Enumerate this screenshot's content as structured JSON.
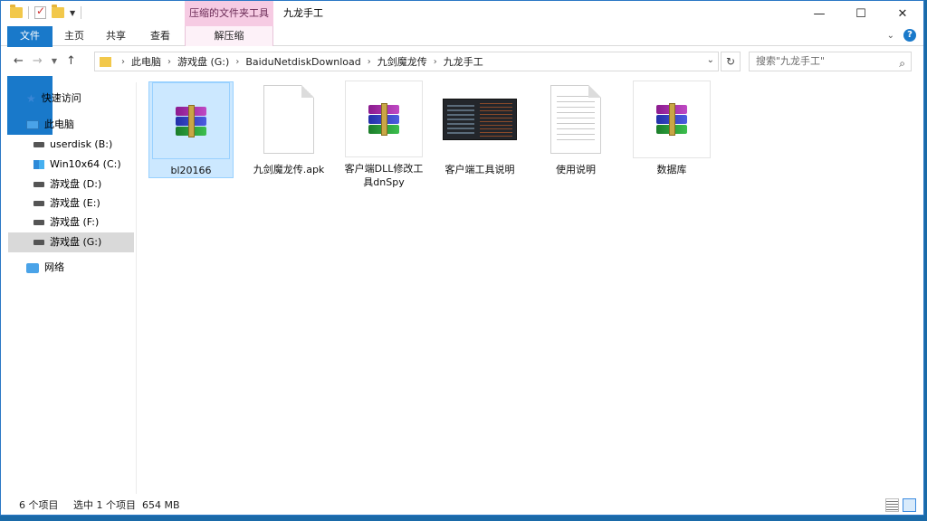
{
  "window": {
    "title": "九龙手工",
    "context_tab_title": "压缩的文件夹工具"
  },
  "ribbon": {
    "tabs": [
      {
        "label": "文件"
      },
      {
        "label": "主页"
      },
      {
        "label": "共享"
      },
      {
        "label": "查看"
      },
      {
        "label": "解压缩"
      }
    ]
  },
  "address": {
    "crumbs": [
      "此电脑",
      "游戏盘 (G:)",
      "BaiduNetdiskDownload",
      "九剑魔龙传",
      "九龙手工"
    ],
    "search_placeholder": "搜索\"九龙手工\""
  },
  "sidebar": {
    "items": [
      {
        "label": "快速访问",
        "icon": "star-icon"
      },
      {
        "label": "此电脑",
        "icon": "computer-icon"
      },
      {
        "label": "userdisk (B:)",
        "icon": "drive-icon"
      },
      {
        "label": "Win10x64 (C:)",
        "icon": "windows-drive-icon"
      },
      {
        "label": "游戏盘 (D:)",
        "icon": "drive-icon"
      },
      {
        "label": "游戏盘 (E:)",
        "icon": "drive-icon"
      },
      {
        "label": "游戏盘 (F:)",
        "icon": "drive-icon"
      },
      {
        "label": "游戏盘 (G:)",
        "icon": "drive-icon"
      },
      {
        "label": "网络",
        "icon": "network-icon"
      }
    ]
  },
  "files": [
    {
      "name": "bl20166",
      "icon": "winrar-archive-icon"
    },
    {
      "name": "九剑魔龙传.apk",
      "icon": "blank-document-icon"
    },
    {
      "name": "客户端DLL修改工具dnSpy",
      "icon": "winrar-archive-icon"
    },
    {
      "name": "客户端工具说明",
      "icon": "screenshot-thumbnail-icon"
    },
    {
      "name": "使用说明",
      "icon": "text-document-icon"
    },
    {
      "name": "数据库",
      "icon": "winrar-archive-icon"
    }
  ],
  "status": {
    "item_count": "6 个项目",
    "selected": "选中 1 个项目",
    "size": "654 MB"
  }
}
